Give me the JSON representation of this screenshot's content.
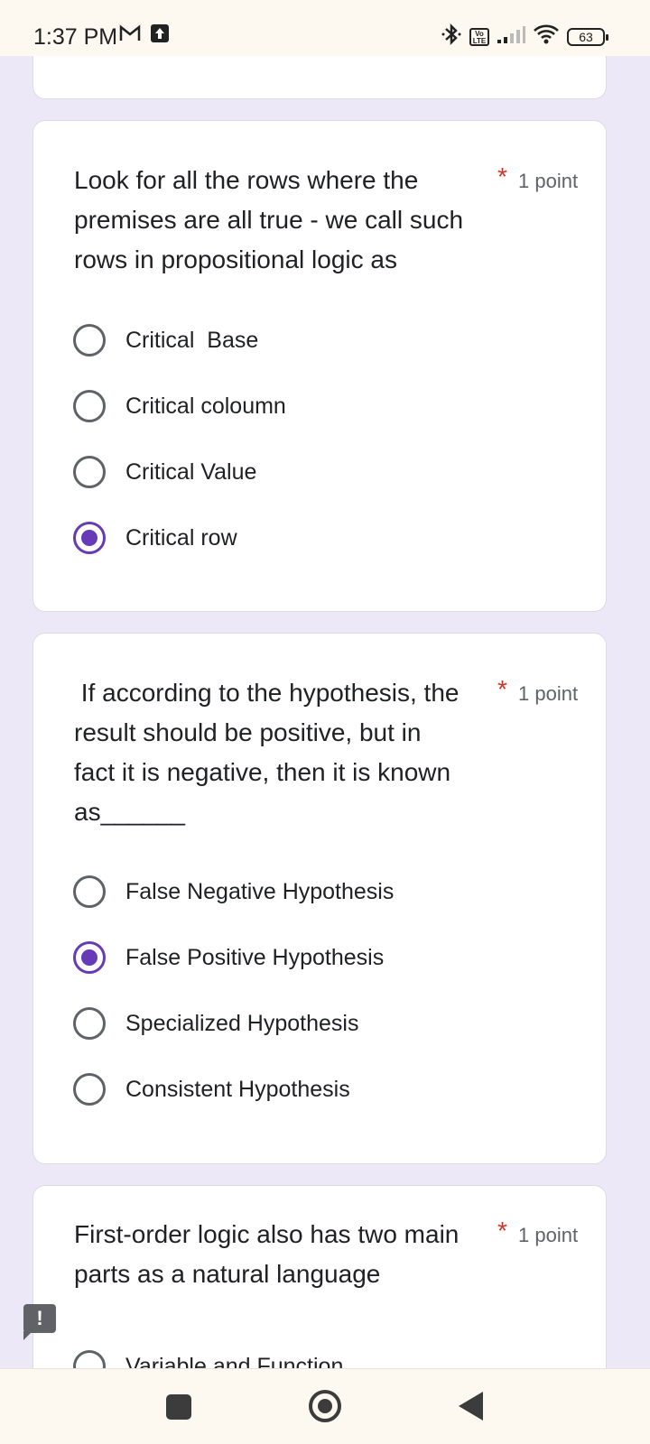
{
  "status_bar": {
    "time": "1:37 PM",
    "battery": "63",
    "left_icons": [
      "gmail-icon",
      "upload-icon"
    ],
    "right_icons": [
      "bluetooth-icon",
      "volte-icon",
      "signal-icon",
      "wifi-icon",
      "battery-icon"
    ],
    "volte_label": "Vo LTE"
  },
  "questions": [
    {
      "title": "Look for all the rows where the\npremises are all true - we call such\nrows in propositional logic as",
      "required": "*",
      "points": "1 point",
      "options": [
        {
          "label": "Critical  Base",
          "selected": false
        },
        {
          "label": "Critical coloumn",
          "selected": false
        },
        {
          "label": "Critical Value",
          "selected": false
        },
        {
          "label": "Critical row",
          "selected": true
        }
      ]
    },
    {
      "title": " If according to the hypothesis, the\nresult should be positive, but in\nfact it is negative, then it is known\nas______",
      "required": "*",
      "points": "1 point",
      "options": [
        {
          "label": "False Negative Hypothesis",
          "selected": false
        },
        {
          "label": "False Positive Hypothesis",
          "selected": true
        },
        {
          "label": "Specialized Hypothesis",
          "selected": false
        },
        {
          "label": "Consistent Hypothesis",
          "selected": false
        }
      ]
    },
    {
      "title": "First-order logic also has two main\nparts as a natural language",
      "required": "*",
      "points": "1 point",
      "options": [
        {
          "label": "Variable and Function",
          "selected": false
        }
      ]
    }
  ],
  "feedback": {
    "label": "!"
  },
  "nav_bar": {
    "icons": [
      "recents-icon",
      "home-icon",
      "back-icon"
    ]
  },
  "colors": {
    "accent": "#673ab7",
    "required": "#d93025",
    "background": "#ede8f8"
  }
}
